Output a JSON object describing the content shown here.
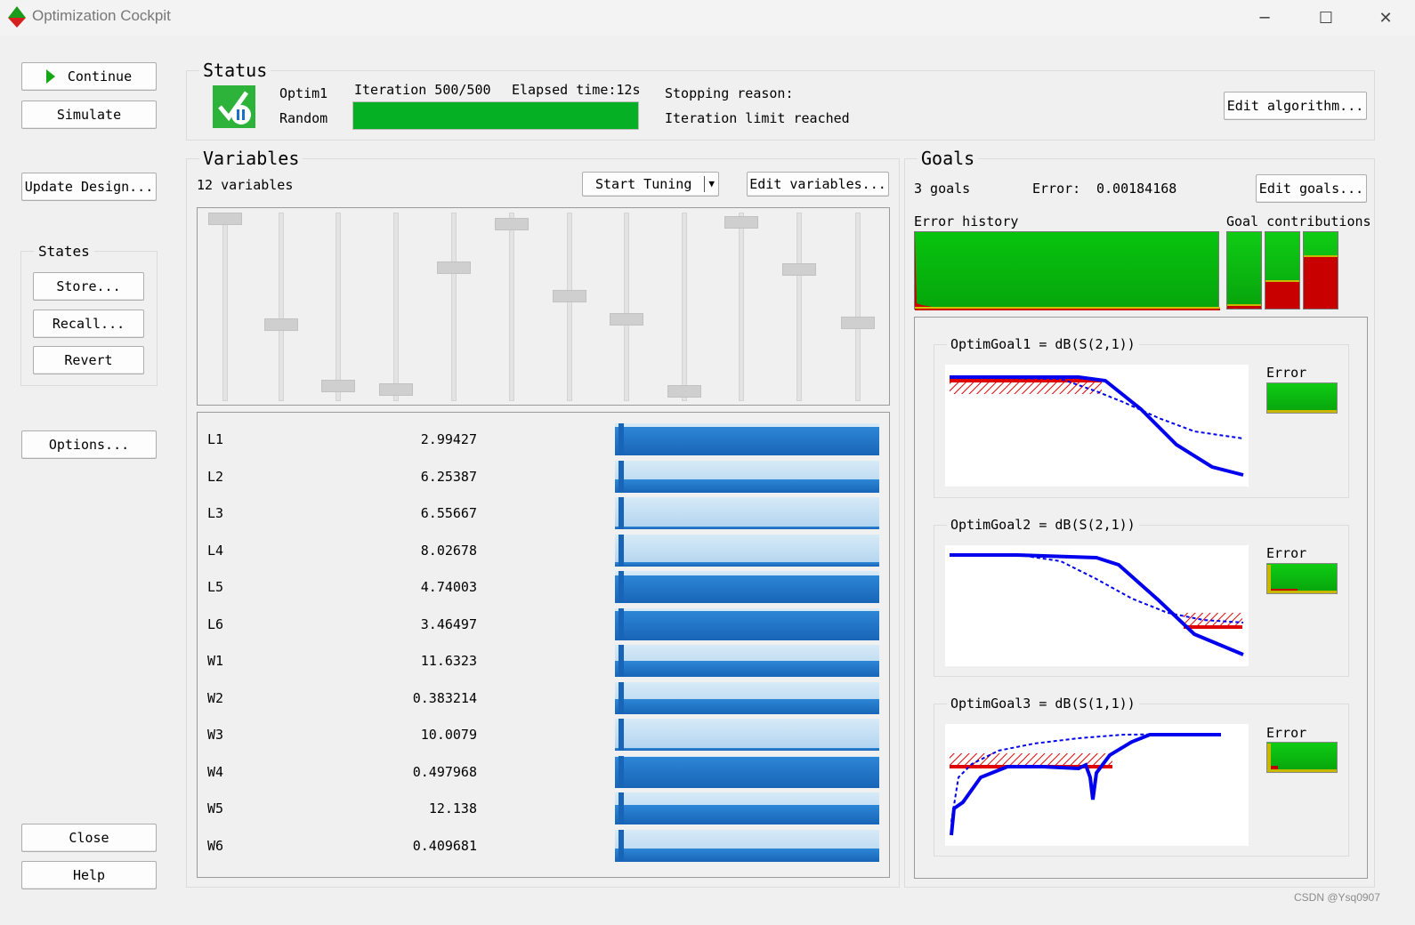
{
  "window": {
    "title": "Optimization Cockpit",
    "controls": {
      "minimize": "─",
      "maximize": "☐",
      "close": "✕"
    }
  },
  "left_panel": {
    "continue": "Continue",
    "simulate": "Simulate",
    "update_design": "Update Design...",
    "states_title": "States",
    "store": "Store...",
    "recall": "Recall...",
    "revert": "Revert",
    "options": "Options...",
    "close": "Close",
    "help": "Help"
  },
  "status": {
    "title": "Status",
    "algorithm": "Optim1",
    "mode": "Random",
    "iteration": "Iteration 500/500",
    "elapsed": "Elapsed time:12s",
    "progress": 1.0,
    "stopping_label": "Stopping reason:",
    "stopping_reason": "Iteration limit reached",
    "edit_algorithm": "Edit algorithm..."
  },
  "variables": {
    "title": "Variables",
    "count": "12 variables",
    "start_tuning": "Start Tuning",
    "edit_variables": "Edit variables...",
    "slider_levels": [
      1.0,
      0.4,
      0.05,
      0.03,
      0.72,
      0.97,
      0.56,
      0.43,
      0.02,
      0.98,
      0.71,
      0.41
    ],
    "rows": [
      {
        "name": "L1",
        "value": "2.99427",
        "level": 0.9
      },
      {
        "name": "L2",
        "value": "6.25387",
        "level": 0.4
      },
      {
        "name": "L3",
        "value": "6.55667",
        "level": 0.08
      },
      {
        "name": "L4",
        "value": "8.02678",
        "level": 0.12
      },
      {
        "name": "L5",
        "value": "4.74003",
        "level": 0.85
      },
      {
        "name": "L6",
        "value": "3.46497",
        "level": 0.9
      },
      {
        "name": "W1",
        "value": "11.6323",
        "level": 0.5
      },
      {
        "name": "W2",
        "value": "0.383214",
        "level": 0.45
      },
      {
        "name": "W3",
        "value": "10.0079",
        "level": 0.08
      },
      {
        "name": "W4",
        "value": "0.497968",
        "level": 0.95
      },
      {
        "name": "W5",
        "value": "12.138",
        "level": 0.6
      },
      {
        "name": "W6",
        "value": "0.409681",
        "level": 0.4
      }
    ]
  },
  "goals": {
    "title": "Goals",
    "count": "3 goals",
    "error_label": "Error:",
    "error_value": "0.00184168",
    "edit_goals": "Edit goals...",
    "error_history_label": "Error history",
    "goal_contributions_label": "Goal contributions",
    "contributions": [
      0.03,
      0.35,
      0.67
    ],
    "plots": [
      {
        "title": "OptimGoal1 = dB(S(2,1))",
        "error_label": "Error"
      },
      {
        "title": "OptimGoal2 = dB(S(2,1))",
        "error_label": "Error"
      },
      {
        "title": "OptimGoal3 = dB(S(1,1))",
        "error_label": "Error"
      }
    ]
  },
  "watermark": "CSDN @Ysq0907",
  "colors": {
    "accent_green": "#0fcc14",
    "bar_blue": "#1c6fc4",
    "goal_red": "#e00000",
    "curve_blue": "#0000ee"
  }
}
